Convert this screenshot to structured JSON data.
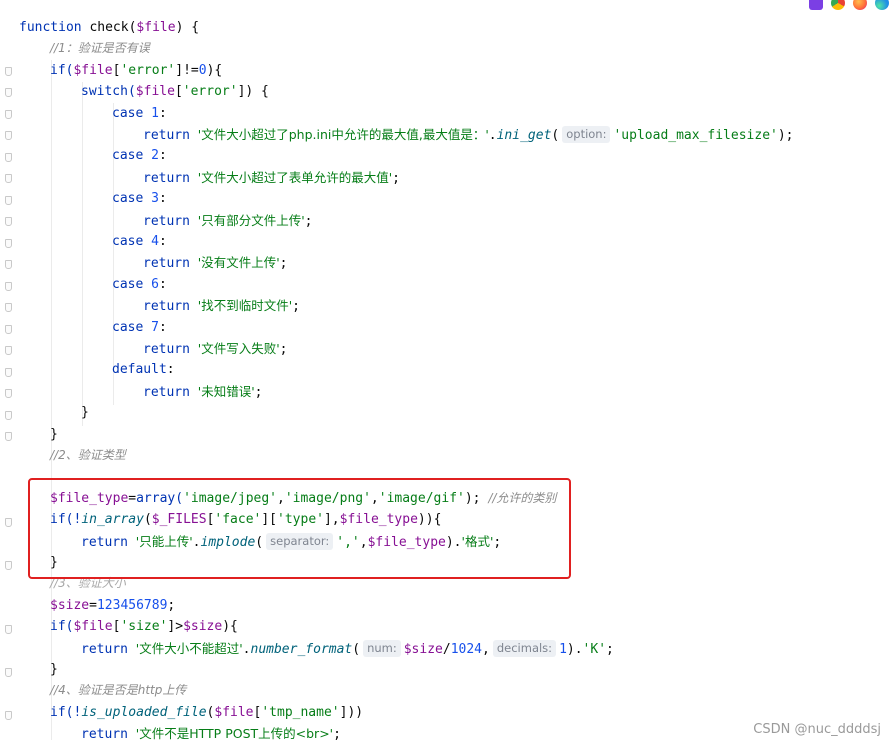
{
  "browser_icons": [
    {
      "name": "phpstorm-icon",
      "color": "#7b3fe4"
    },
    {
      "name": "chrome-icon",
      "color": "#e94235"
    },
    {
      "name": "firefox-icon",
      "color": "#ff7139"
    },
    {
      "name": "edge-icon",
      "color": "#1f8ee6"
    }
  ],
  "code": {
    "l1": {
      "kw": "function",
      "rest": " check(",
      "var": "$file",
      "end": ") {"
    },
    "l2": {
      "comment": "//1：验证是否有误"
    },
    "l3": {
      "kw": "if(",
      "var": "$file",
      "a": "[",
      "str": "'error'",
      "b": "]!=",
      "num": "0",
      "c": "){"
    },
    "l4": {
      "kw": "switch(",
      "var": "$file",
      "a": "[",
      "str": "'error'",
      "b": "]) {"
    },
    "l5": {
      "kw": "case ",
      "num": "1",
      "c": ":"
    },
    "l6": {
      "kw": "return ",
      "str": "'文件大小超过了php.ini中允许的最大值,最大值是：'",
      "dot": ".",
      "fn": "ini_get",
      "p": "(",
      "hint": "option:",
      "str2": "'upload_max_filesize'",
      "end": ");"
    },
    "l7": {
      "kw": "case ",
      "num": "2",
      "c": ":"
    },
    "l8": {
      "kw": "return ",
      "str": "'文件大小超过了表单允许的最大值'",
      "end": ";"
    },
    "l9": {
      "kw": "case ",
      "num": "3",
      "c": ":"
    },
    "l10": {
      "kw": "return ",
      "str": "'只有部分文件上传'",
      "end": ";"
    },
    "l11": {
      "kw": "case ",
      "num": "4",
      "c": ":"
    },
    "l12": {
      "kw": "return ",
      "str": "'没有文件上传'",
      "end": ";"
    },
    "l13": {
      "kw": "case ",
      "num": "6",
      "c": ":"
    },
    "l14": {
      "kw": "return ",
      "str": "'找不到临时文件'",
      "end": ";"
    },
    "l15": {
      "kw": "case ",
      "num": "7",
      "c": ":"
    },
    "l16": {
      "kw": "return ",
      "str": "'文件写入失败'",
      "end": ";"
    },
    "l17": {
      "kw": "default",
      "c": ":"
    },
    "l18": {
      "kw": "return ",
      "str": "'未知错误'",
      "end": ";"
    },
    "l19": {
      "text": "}"
    },
    "l20": {
      "text": "}"
    },
    "l21": {
      "comment": "//2、验证类型"
    },
    "l23": {
      "var": "$file_type",
      "eq": "=",
      "kw": "array(",
      "s1": "'image/jpeg'",
      "c1": ",",
      "s2": "'image/png'",
      "c2": ",",
      "s3": "'image/gif'",
      "end": "); ",
      "comment": "//允许的类别"
    },
    "l24": {
      "kw": "if(!",
      "fn": "in_array",
      "p": "(",
      "var": "$_FILES",
      "a": "[",
      "s1": "'face'",
      "b": "][",
      "s2": "'type'",
      "c": "],",
      "var2": "$file_type",
      "end": ")){"
    },
    "l25": {
      "kw": "return ",
      "str": "'只能上传'",
      "dot": ".",
      "fn": "implode",
      "p": "(",
      "hint": "separator:",
      "s2": "','",
      "c": ",",
      "var": "$file_type",
      "e1": ").",
      "s3": "'格式'",
      "end": ";"
    },
    "l26": {
      "text": "}"
    },
    "l27": {
      "comment": "//3、验证大小"
    },
    "l28": {
      "var": "$size",
      "eq": "=",
      "num": "123456789",
      "end": ";"
    },
    "l29": {
      "kw": "if(",
      "var": "$file",
      "a": "[",
      "str": "'size'",
      "b": "]>",
      "var2": "$size",
      "end": "){"
    },
    "l30": {
      "kw": "return ",
      "str": "'文件大小不能超过'",
      "dot": ".",
      "fn": "number_format",
      "p": "(",
      "hint": "num:",
      "var": "$size",
      "div": "/",
      "num": "1024",
      "c": ",",
      "hint2": "decimals:",
      "num2": "1",
      "e1": ").",
      "s3": "'K'",
      "end": ";"
    },
    "l31": {
      "text": "}"
    },
    "l32": {
      "comment": "//4、验证是否是http上传"
    },
    "l33": {
      "kw": "if(!",
      "fn": "is_uploaded_file",
      "p": "(",
      "var": "$file",
      "a": "[",
      "str": "'tmp_name'",
      "end": "]))"
    },
    "l34": {
      "kw": "return ",
      "str": "'文件不是HTTP POST上传的<br>'",
      "end": ";"
    }
  },
  "watermark": "CSDN @nuc_ddddsj"
}
